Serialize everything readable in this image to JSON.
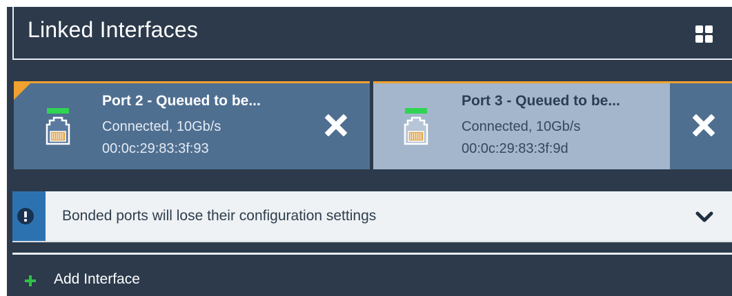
{
  "header": {
    "title": "Linked Interfaces",
    "layout_icon": "grid-layout-icon"
  },
  "interfaces": [
    {
      "name": "Port 2 - Queued to be...",
      "status": "Connected, 10Gb/s",
      "mac": "00:0c:29:83:3f:93",
      "icon": "ethernet-port-icon",
      "remove_icon": "close-icon"
    },
    {
      "name": "Port 3 - Queued to be...",
      "status": "Connected, 10Gb/s",
      "mac": "00:0c:29:83:3f:9d",
      "icon": "ethernet-port-icon",
      "remove_icon": "close-icon"
    }
  ],
  "alert": {
    "icon": "exclamation-icon",
    "message": "Bonded ports will lose their configuration settings",
    "toggle_icon": "chevron-down-icon"
  },
  "add_interface": {
    "icon": "plus-icon",
    "label": "Add Interface"
  },
  "colors": {
    "panel": "#2c3a4b",
    "accent": "#f0a12f",
    "card_primary": "#4f6f91",
    "card_secondary": "#a4b6cb",
    "link_led": "#2fd451",
    "alert_stripe": "#2d72b0",
    "add_icon": "#2fc245"
  }
}
